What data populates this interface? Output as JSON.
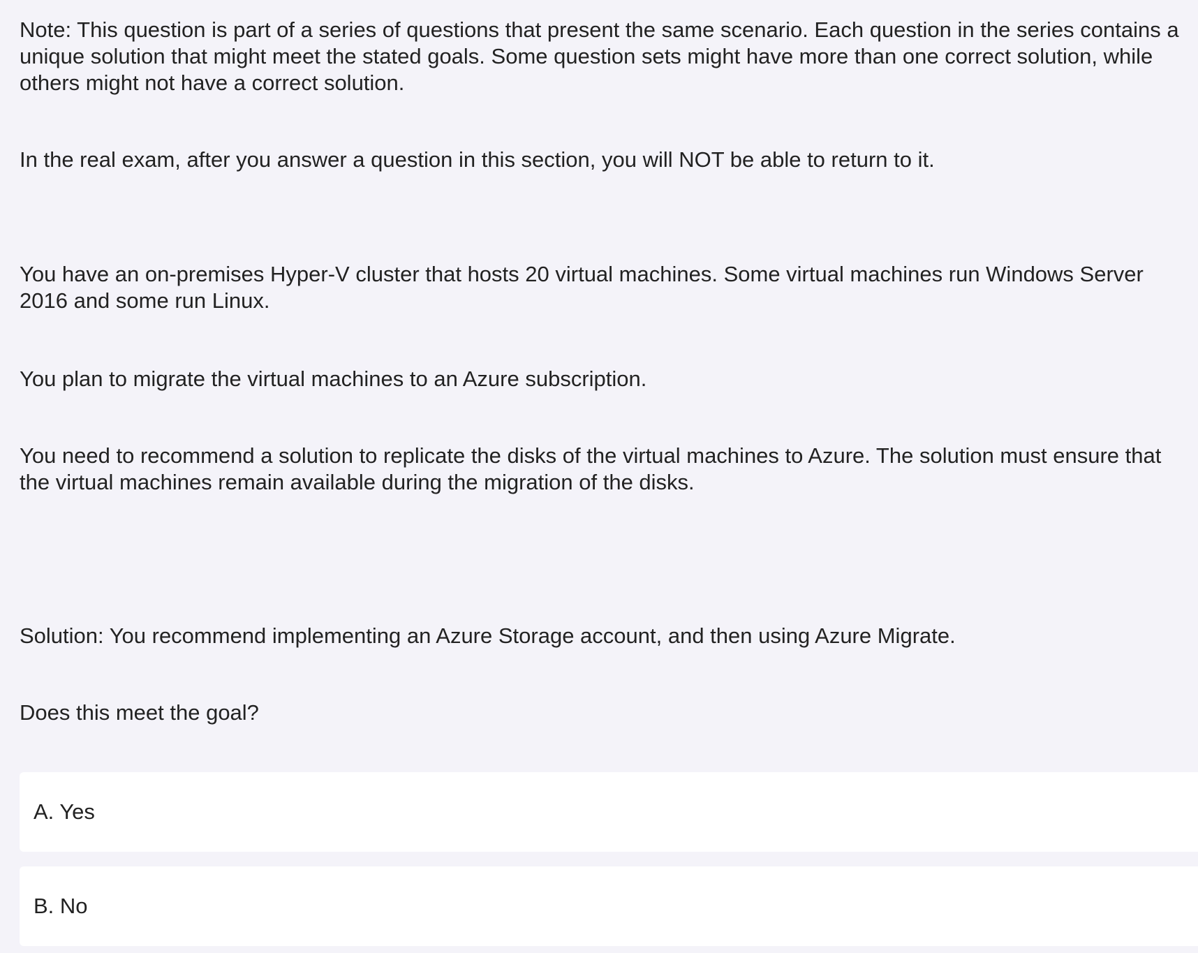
{
  "question": {
    "note": "Note: This question is part of a series of questions that present the same scenario. Each question in the series contains a unique solution that might meet the stated goals. Some question sets might have more than one correct solution, while others might not have a correct solution.",
    "exam_notice": "In the real exam, after you answer a question in this section, you will NOT be able to return to it.",
    "scenario": "You have an on-premises Hyper-V cluster that hosts 20 virtual machines. Some virtual machines run Windows Server 2016 and some run Linux.",
    "plan": "You plan to migrate the virtual machines to an Azure subscription.",
    "requirement": "You need to recommend a solution to replicate the disks of the virtual machines to Azure. The solution must ensure that the virtual machines remain available during the migration of the disks.",
    "solution": "Solution: You recommend implementing an Azure Storage account, and then using Azure Migrate.",
    "prompt": "Does this meet the goal?"
  },
  "options": [
    {
      "label": "A. Yes"
    },
    {
      "label": "B. No"
    }
  ],
  "colors": {
    "background": "#f4f3f9",
    "card": "#ffffff",
    "text": "#222222"
  }
}
